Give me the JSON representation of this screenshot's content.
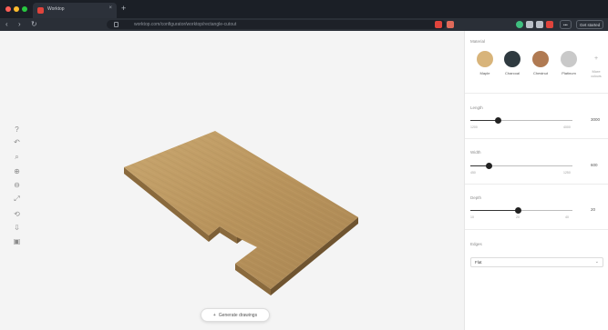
{
  "browser": {
    "tab_title": "Worktop",
    "tab_close": "×",
    "new_tab": "+",
    "url": "worktop.com/configurator/worktop/rectangle-cutout",
    "back": "‹",
    "forward": "›",
    "reload": "↻",
    "buttons": [
      "•••",
      "Get started"
    ]
  },
  "viewport": {
    "tools": [
      "?",
      "↶",
      "⌕",
      "⊕",
      "⊖",
      "⤢",
      "⟲",
      "⇩",
      "▣"
    ],
    "generate_label": "Generate drawings",
    "generate_icon": "+"
  },
  "panel": {
    "material_label": "Material",
    "materials": [
      {
        "name": "Maple",
        "color": "#d8b47a"
      },
      {
        "name": "Charcoal",
        "color": "#2f3a40"
      },
      {
        "name": "Chestnut",
        "color": "#b07a52"
      },
      {
        "name": "Platinum",
        "color": "#c9c9c9"
      },
      {
        "name": "More",
        "sub": "colours",
        "color": "#ffffff",
        "icon": "+"
      }
    ],
    "sliders": [
      {
        "label": "Length",
        "value": "3000",
        "min": "1200",
        "max": "4000",
        "fraction": 0.27
      },
      {
        "label": "Width",
        "value": "600",
        "min": "450",
        "max": "1250",
        "fraction": 0.18
      },
      {
        "label": "Depth",
        "value": "20",
        "min": "10",
        "mid": "20",
        "max": "40",
        "fraction": 0.47
      }
    ],
    "edges_label": "Edges",
    "edges_value": "Flat",
    "edges_caret": "⌄"
  }
}
